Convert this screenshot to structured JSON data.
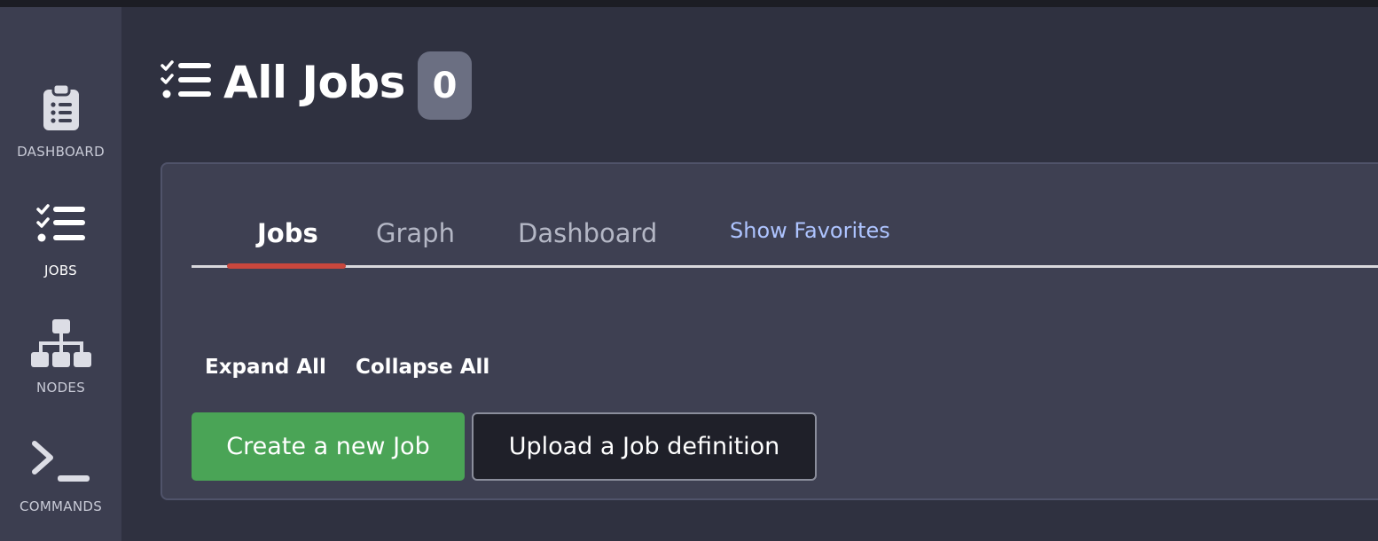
{
  "sidebar": {
    "items": [
      {
        "label": "DASHBOARD",
        "icon": "clipboard-list-icon"
      },
      {
        "label": "JOBS",
        "icon": "tasks-icon"
      },
      {
        "label": "NODES",
        "icon": "sitemap-icon"
      },
      {
        "label": "COMMANDS",
        "icon": "terminal-icon"
      }
    ]
  },
  "header": {
    "title": "All Jobs",
    "count": "0",
    "icon": "tasks-icon"
  },
  "tabs": [
    {
      "label": "Jobs",
      "active": true
    },
    {
      "label": "Graph",
      "active": false
    },
    {
      "label": "Dashboard",
      "active": false
    }
  ],
  "favorites_link": "Show Favorites",
  "actions": {
    "expand_all": "Expand All",
    "collapse_all": "Collapse All",
    "create_job": "Create a new Job",
    "upload_job": "Upload a Job definition"
  },
  "colors": {
    "sidebar_bg": "#3c3e50",
    "main_bg": "#2f3140",
    "panel_bg": "#3e4052",
    "active_tab_underline": "#c8473d",
    "create_button": "#4aa456",
    "favorites_link": "#aec4ff",
    "badge_bg": "#6b6f82"
  }
}
